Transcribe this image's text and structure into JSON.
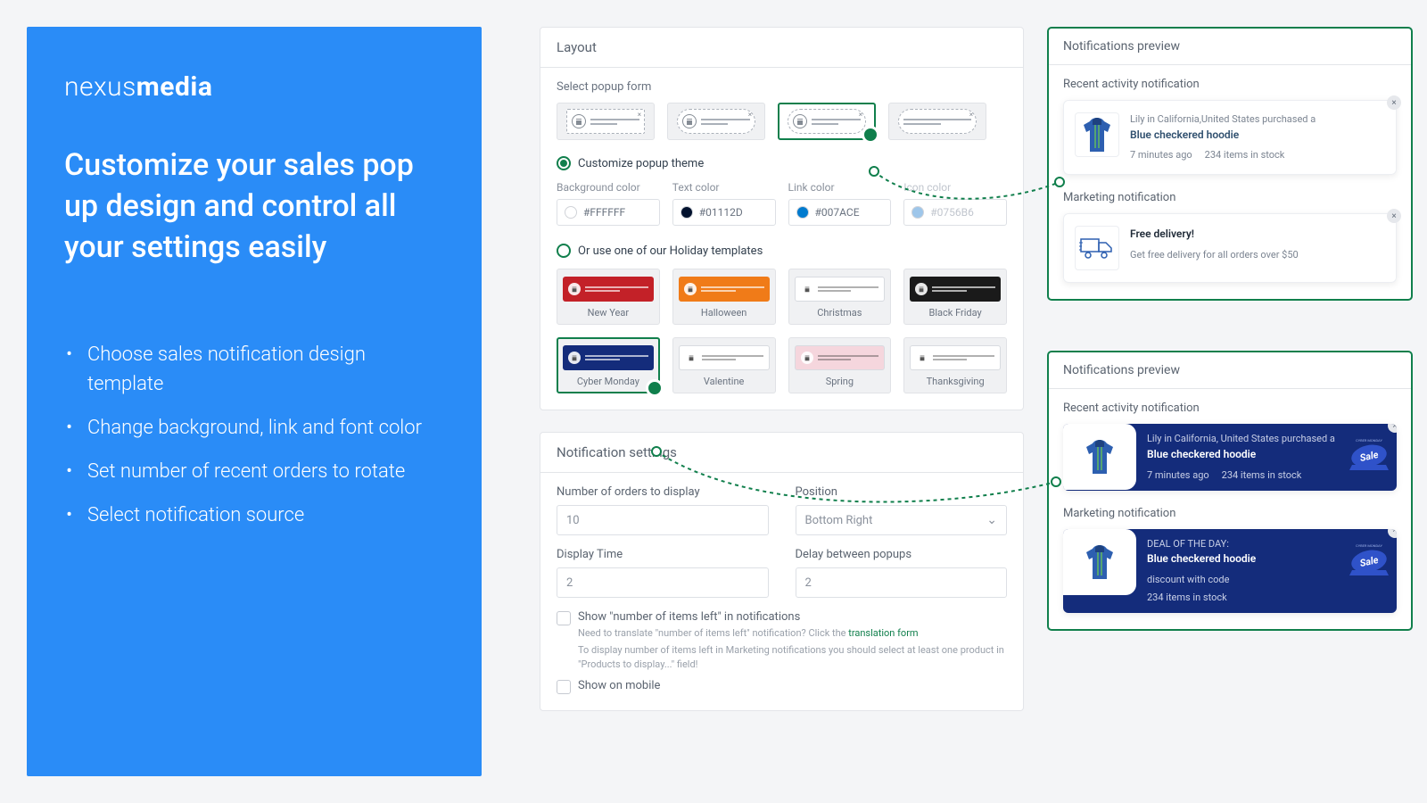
{
  "promo": {
    "brand_light": "nexus",
    "brand_bold": "media",
    "headline": "Customize your sales pop up design and control all your settings easily",
    "bullets": [
      "Choose sales notification design template",
      "Change background, link and font color",
      "Set number of recent orders to rotate",
      "Select notification source"
    ]
  },
  "layout": {
    "title": "Layout",
    "select_popup_label": "Select popup form",
    "customize_radio": "Customize popup theme",
    "colors": {
      "bg": {
        "label": "Background color",
        "value": "#FFFFFF",
        "hex": "#FFFFFF"
      },
      "text": {
        "label": "Text color",
        "value": "#01112D",
        "hex": "#01112D"
      },
      "link": {
        "label": "Link color",
        "value": "#007ACE",
        "hex": "#007ACE"
      },
      "icon": {
        "label": "Icon color",
        "value": "#0756B6",
        "hex": "#9ec6ea"
      }
    },
    "holiday_radio": "Or use one of our Holiday templates",
    "templates": [
      {
        "name": "New Year",
        "bg": "#c32128",
        "light": false
      },
      {
        "name": "Halloween",
        "bg": "#f07b18",
        "light": false
      },
      {
        "name": "Christmas",
        "bg": "#ffffff",
        "light": true
      },
      {
        "name": "Black Friday",
        "bg": "#1a1a1a",
        "light": false
      },
      {
        "name": "Cyber Monday",
        "bg": "#142c7b",
        "light": false
      },
      {
        "name": "Valentine",
        "bg": "#ffffff",
        "light": true
      },
      {
        "name": "Spring",
        "bg": "#f5d6dd",
        "light": true
      },
      {
        "name": "Thanksgiving",
        "bg": "#ffffff",
        "light": true
      }
    ]
  },
  "notif_settings": {
    "title": "Notification settings",
    "orders": {
      "label": "Number of orders to display",
      "value": "10"
    },
    "position": {
      "label": "Position",
      "value": "Bottom Right"
    },
    "display_time": {
      "label": "Display Time",
      "value": "2"
    },
    "delay": {
      "label": "Delay between popups",
      "value": "2"
    },
    "show_items_left": {
      "label": "Show \"number of items left\" in notifications",
      "hint_pre": "Need to translate \"number of items left\" notification? Click the ",
      "hint_link": "translation form",
      "hint_2": "To display number of items left in Marketing notifications you should select at least one product in \"Products to display...\" field!"
    },
    "show_mobile": "Show on mobile"
  },
  "preview": {
    "title": "Notifications preview",
    "recent_label": "Recent activity notification",
    "marketing_label": "Marketing notification",
    "recent1": {
      "line1": "Lily in California,United States purchased a",
      "title": "Blue checkered hoodie",
      "meta1": "7 minutes ago",
      "meta2": "234 items in stock"
    },
    "marketing1": {
      "title": "Free delivery!",
      "line2": "Get free delivery for all orders over $50"
    },
    "recent2": {
      "line1": "Lily in California, United States purchased a",
      "title": "Blue checkered hoodie",
      "meta1": "7 minutes ago",
      "meta2": "234 items in stock"
    },
    "marketing2": {
      "line1": "DEAL OF THE DAY:",
      "title": "Blue checkered hoodie",
      "line2": "discount with code",
      "meta": "234 items in stock"
    },
    "cyber_badge": "CYBER MONDAY",
    "sale": "Sale"
  }
}
